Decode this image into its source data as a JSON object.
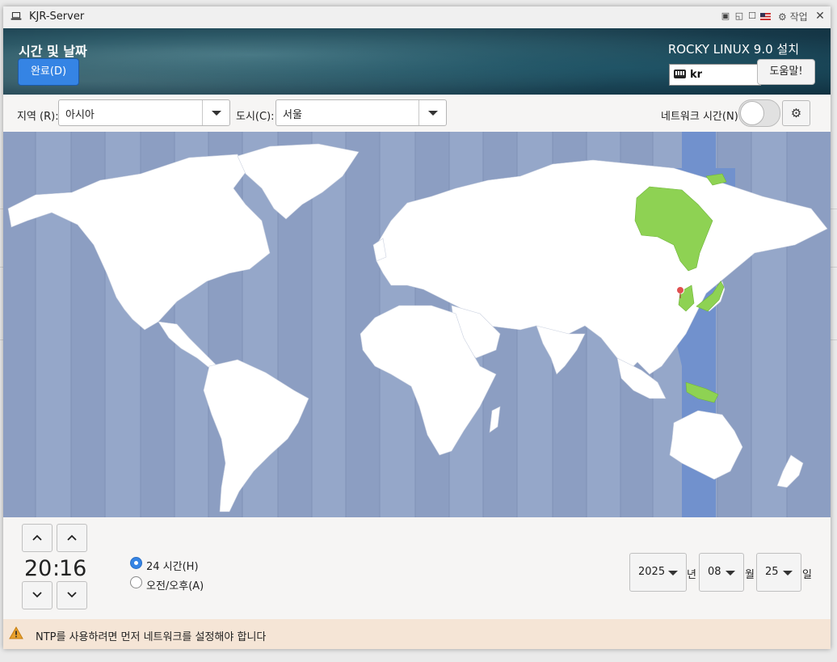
{
  "window": {
    "title": "KJR-Server",
    "work_label": "작업"
  },
  "header": {
    "title": "시간 및 날짜",
    "done_label": "완료(D)",
    "product": "ROCKY LINUX 9.0 설치",
    "keyboard_layout": "kr",
    "help_label": "도움말!"
  },
  "toolbar": {
    "region_label": "지역 (R):",
    "region_value": "아시아",
    "city_label": "도시(C):",
    "city_value": "서울",
    "network_time_label": "네트워크 시간(N)",
    "network_time_on": false
  },
  "map": {
    "selected_city": "서울",
    "colors": {
      "ocean": "#95a7c9",
      "land": "#ffffff",
      "selected_zone": "#7191cd",
      "selected_land": "#8ed253",
      "pin": "#e05050"
    }
  },
  "time": {
    "hours": "20",
    "separator": ":",
    "minutes": "16"
  },
  "format": {
    "h24_label": "24 시간(H)",
    "ampm_label": "오전/오후(A)",
    "selected": "24h"
  },
  "date": {
    "year": "2025",
    "year_unit": "년",
    "month": "08",
    "month_unit": "월",
    "day": "25",
    "day_unit": "일"
  },
  "warning": {
    "text": "NTP를 사용하려면 먼저 네트워크를 설정해야 합니다"
  }
}
